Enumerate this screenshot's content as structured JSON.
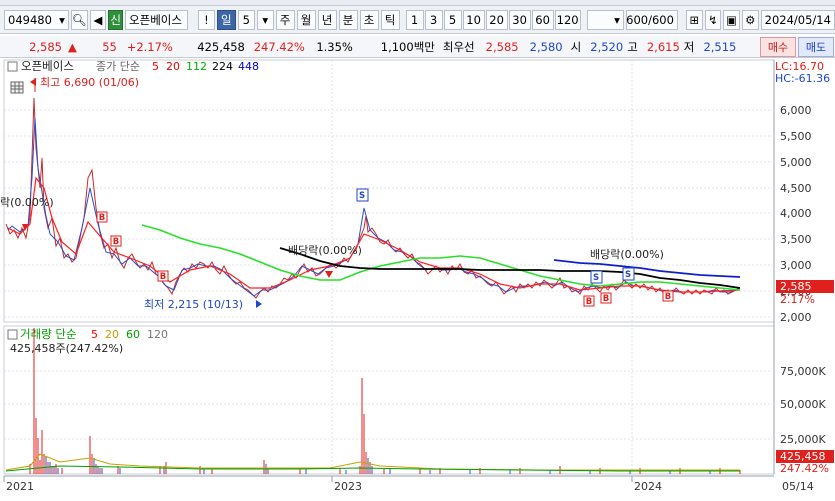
{
  "toolbar": {
    "code": "049480",
    "type_badge": "신",
    "stock_name": "오픈베이스",
    "period_day": "일",
    "period_num": "5",
    "period_week": "주",
    "period_month": "월",
    "period_year": "년",
    "period_minute": "분",
    "period_second": "초",
    "period_tick": "틱",
    "nums": [
      "1",
      "3",
      "5",
      "10",
      "20",
      "30",
      "60",
      "120"
    ],
    "count": "600",
    "count_total": "/600",
    "date": "2024/05/14"
  },
  "quote": {
    "price": "2,585",
    "change_arrow": "▲",
    "change": "55",
    "change_pct": "+2.17%",
    "volume": "425,458",
    "vol_ratio": "247.42%",
    "turnover": "1.35%",
    "amount": "1,100백만",
    "prefer_label": "최우선",
    "ask": "2,585",
    "bid": "2,580",
    "open_label": "시",
    "open": "2,520",
    "high_label": "고",
    "high": "2,615",
    "low_label": "저",
    "low": "2,515",
    "buy": "매수",
    "sell": "매도"
  },
  "price_panel": {
    "title": "오픈베이스",
    "ma_label": "종가 단순",
    "ma_periods": [
      "5",
      "20",
      "112",
      "224",
      "448"
    ],
    "lc": "LC:16.70",
    "hc": "HC:-61.36",
    "high_annot": "최고 6,690 (01/06)",
    "low_annot": "최저 2,215 (10/13)",
    "div_annot_left": "락(0.00%)",
    "div_annot_mid": "배당락(0.00%)",
    "div_annot_right": "배당락(0.00%)",
    "y_ticks": [
      "6,000",
      "5,500",
      "5,000",
      "4,500",
      "4,000",
      "3,500",
      "3,000",
      "2,500",
      "2,000"
    ],
    "cur_price": "2,585",
    "cur_pct": "2.17%"
  },
  "volume_panel": {
    "title": "거래량 단순",
    "ma_periods": [
      "5",
      "20",
      "60",
      "120"
    ],
    "vol_annot": "425,458주(247.42%)",
    "y_ticks": [
      "75,000K",
      "50,000K",
      "25,000K"
    ],
    "cur_vol": "425,458",
    "cur_pct": "247.42%"
  },
  "x_axis": {
    "labels": [
      "2021",
      "2023",
      "2024",
      "05/14"
    ]
  },
  "colors": {
    "up": "#e0201c",
    "down": "#1f47c9",
    "ma5": "#ff0000",
    "ma20": "#e60000",
    "ma112": "#00c800",
    "ma224": "#000000",
    "ma448": "#0000cc"
  }
}
